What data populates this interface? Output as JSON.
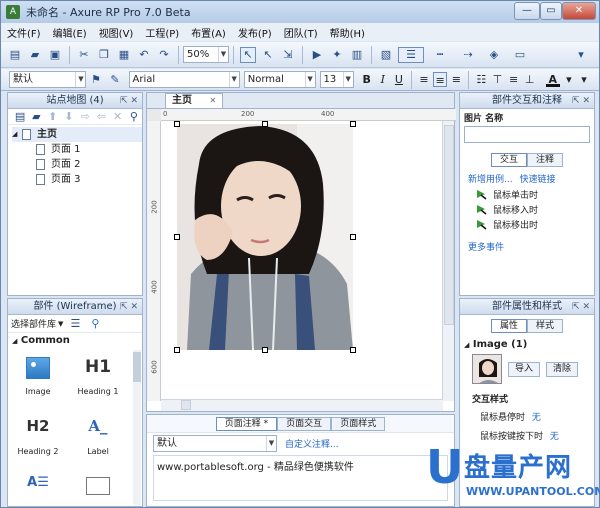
{
  "window": {
    "title": "未命名 - Axure RP Pro 7.0 Beta",
    "app_icon_glyph": "A",
    "controls": {
      "minimize": "—",
      "maximize": "▭",
      "close": "✕"
    }
  },
  "menu": [
    "文件(F)",
    "编辑(E)",
    "视图(V)",
    "工程(P)",
    "布置(A)",
    "发布(P)",
    "团队(T)",
    "帮助(H)"
  ],
  "toolbar": {
    "zoom": "50%"
  },
  "format_bar": {
    "style_value": "默认",
    "font_value": "Arial",
    "weight_value": "Normal",
    "size_value": "13",
    "bold": "B",
    "italic": "I",
    "underline": "U",
    "font_color_glyph": "A"
  },
  "sitemap": {
    "title": "站点地图 (4)",
    "root": "主页",
    "pages": [
      "页面 1",
      "页面 2",
      "页面 3"
    ]
  },
  "widgets": {
    "title": "部件 (Wireframe)",
    "library_select": "选择部件库",
    "group": "Common",
    "items": [
      {
        "label": "Image",
        "glyph": ""
      },
      {
        "label": "Heading 1",
        "glyph": "H1"
      },
      {
        "label": "Heading 2",
        "glyph": "H2"
      },
      {
        "label": "Label",
        "glyph": "A_"
      }
    ]
  },
  "canvas": {
    "tab": "主页",
    "ruler_h": [
      "0",
      "200",
      "400"
    ],
    "ruler_v": [
      "200",
      "400",
      "600"
    ]
  },
  "page_notes": {
    "tabs": [
      "页面注释",
      "页面交互",
      "页面样式"
    ],
    "active_tab_marker": "*",
    "select_value": "默认",
    "custom_notes_link": "自定义注释...",
    "text": "www.portablesoft.org - 精品绿色便携软件"
  },
  "interactions_panel": {
    "title": "部件交互和注释",
    "fields_label": "图片 名称",
    "tabs": [
      "交互",
      "注释"
    ],
    "links": [
      "新增用例...",
      "快速链接"
    ],
    "events": [
      "鼠标单击时",
      "鼠标移入时",
      "鼠标移出时"
    ],
    "more_events": "更多事件"
  },
  "properties_panel": {
    "title": "部件属性和样式",
    "tabs": [
      "属性",
      "样式"
    ],
    "section": "Image (1)",
    "import_button": "导入",
    "clear_button": "清除",
    "interaction_style_label": "交互样式",
    "rows": [
      {
        "label": "鼠标悬停时",
        "value": "无"
      },
      {
        "label": "鼠标按键按下时",
        "value": "无"
      }
    ]
  },
  "watermark": {
    "logo": "U",
    "brand": "盘量产网",
    "url": "WWW.UPANTOOL.COM"
  },
  "colors": {
    "accent": "#2266cc",
    "frame": "#9fb3cf",
    "flag_green": "#3a9a3a"
  }
}
